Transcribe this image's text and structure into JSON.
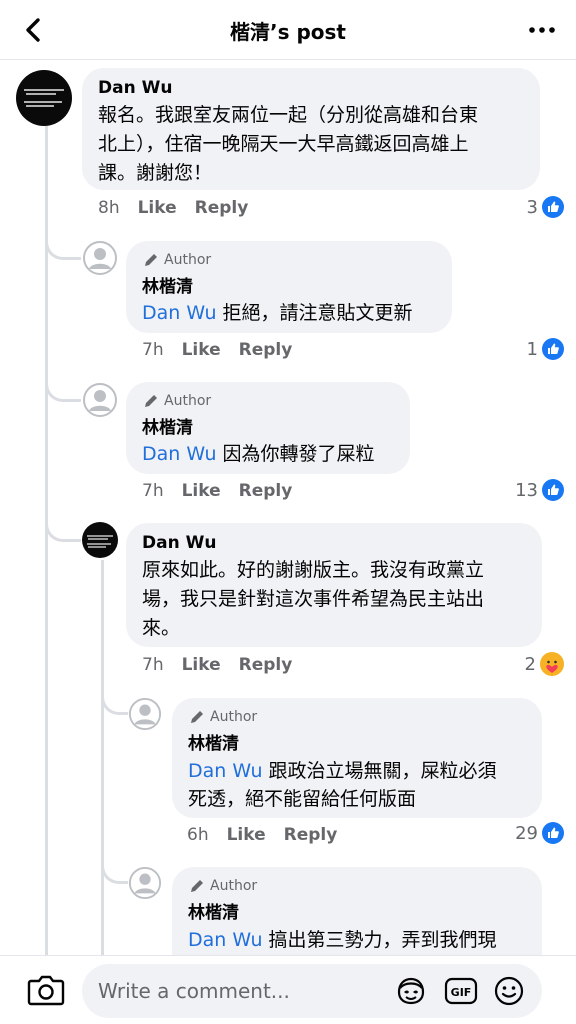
{
  "header": {
    "title": "楷清’s post"
  },
  "comments": [
    {
      "name": "Dan Wu",
      "text_lines": [
        "報名。我跟室友兩位一起（分別從高雄和台東",
        "北上），住宿一晚隔天一大早高鐵返回高雄上",
        "課。謝謝您！"
      ],
      "time": "8h",
      "like_label": "Like",
      "reply_label": "Reply",
      "reactions": "3"
    },
    {
      "author_label": "Author",
      "name": "林楷清",
      "mention": "Dan Wu",
      "text": " 拒絕，請注意貼文更新",
      "time": "7h",
      "like_label": "Like",
      "reply_label": "Reply",
      "reactions": "1"
    },
    {
      "author_label": "Author",
      "name": "林楷清",
      "mention": "Dan Wu",
      "text": " 因為你轉發了屎粒",
      "time": "7h",
      "like_label": "Like",
      "reply_label": "Reply",
      "reactions": "13"
    },
    {
      "name": "Dan Wu",
      "text_lines": [
        "原來如此。好的謝謝版主。我沒有政黨立",
        "場，我只是針對這次事件希望為民主站出",
        "來。"
      ],
      "time": "7h",
      "like_label": "Like",
      "reply_label": "Reply",
      "reactions": "2"
    },
    {
      "author_label": "Author",
      "name": "林楷清",
      "mention": "Dan Wu",
      "text": " 跟政治立場無關，屎粒必須",
      "text_line2": "死透，絕不能留給任何版面",
      "time": "6h",
      "like_label": "Like",
      "reply_label": "Reply",
      "reactions": "29"
    },
    {
      "author_label": "Author",
      "name": "林楷清",
      "mention": "Dan Wu",
      "text": " 搞出第三勢力，弄到我們現"
    }
  ],
  "composer": {
    "placeholder": "Write a comment..."
  },
  "icons": {
    "back": "back-arrow-icon",
    "more": "more-dots-icon",
    "camera": "camera-icon",
    "avatar": "avatar-sticker-icon",
    "gif": "gif-icon",
    "emoji": "emoji-icon",
    "like": "like-reaction-icon",
    "care": "care-reaction-icon",
    "author": "pencil-icon"
  },
  "colors": {
    "accent": "#1877f2",
    "mention": "#216fdb",
    "bubble": "#f0f2f5"
  }
}
